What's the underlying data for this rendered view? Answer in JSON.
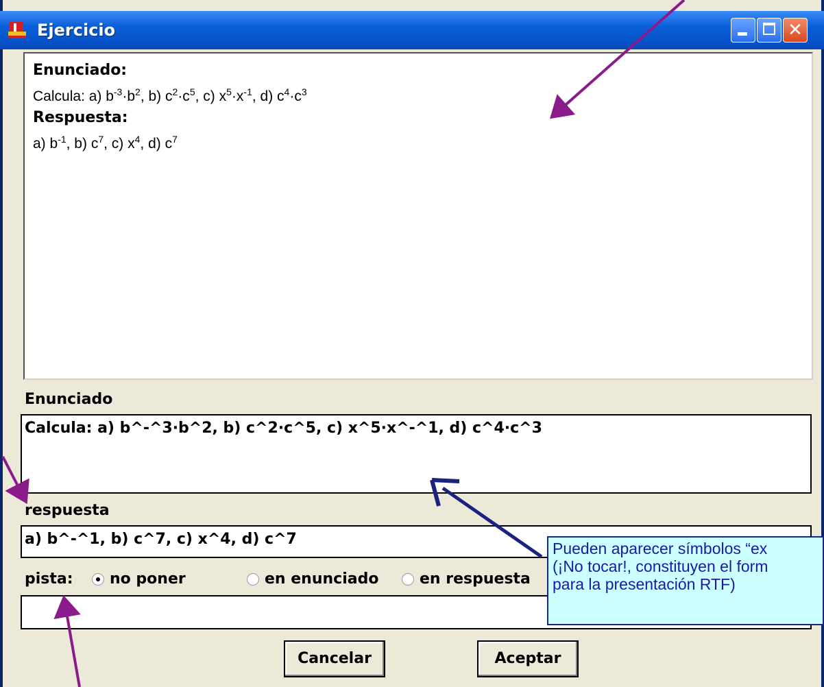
{
  "window": {
    "title": "Ejercicio"
  },
  "preview": {
    "enunciado_heading": "Enunciado:",
    "enunciado_line": {
      "p1": "Calcula: a) b",
      "s1": "-3",
      "p2": "·b",
      "s2": "2",
      "p3": ",  b) c",
      "s3": "2",
      "p4": "·c",
      "s4": "5",
      "p5": ",  c) x",
      "s5": "5",
      "p6": "·x",
      "s6": "-1",
      "p7": ",  d) c",
      "s7": "4",
      "p8": "·c",
      "s8": "3"
    },
    "respuesta_heading": "Respuesta:",
    "respuesta_line": {
      "p1": "a) b",
      "s1": "-1",
      "p2": ",  b) c",
      "s2": "7",
      "p3": ",  c) x",
      "s3": "4",
      "p4": ",  d) c",
      "s4": "7"
    }
  },
  "form": {
    "enunciado_label": "Enunciado",
    "enunciado_value": "Calcula: a) b^-^3·b^2,  b) c^2·c^5,  c) x^5·x^-^1,  d) c^4·c^3",
    "respuesta_label": "respuesta",
    "respuesta_value": "a) b^-^1,  b) c^7,  c) x^4,  d) c^7",
    "pista_label": "pista:",
    "pista_options": [
      "no poner",
      "en enunciado",
      "en respuesta"
    ],
    "pista_selected": "no poner",
    "pista_value": "",
    "cancel_label": "Cancelar",
    "accept_label": "Aceptar"
  },
  "callout": {
    "lines": [
      "Pueden aparecer símbolos “ex",
      "(¡No tocar!, constituyen el form",
      "para la presentación  RTF)"
    ]
  },
  "colors": {
    "titlebar": "#0a5fd8",
    "callout_bg": "#ccffff",
    "callout_text": "#1a1aa8",
    "arrow_purple": "#8b1a8b",
    "arrow_navy": "#1a237e"
  }
}
